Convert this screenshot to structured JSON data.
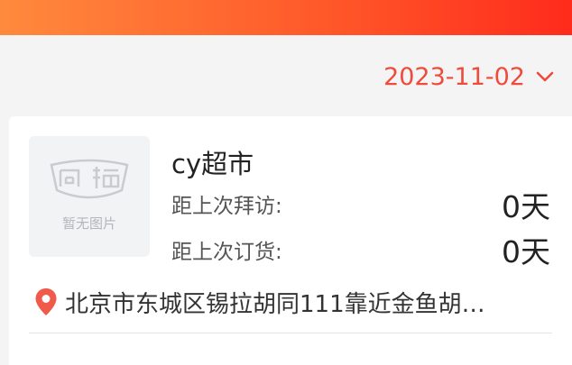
{
  "header": {
    "gradient": [
      "#ff8a3d",
      "#ff5a2a",
      "#ff2b1c"
    ]
  },
  "filter": {
    "date": "2023-11-02",
    "accent": "#f04a3c",
    "icon": "chevron-down-icon"
  },
  "store": {
    "thumbnail_placeholder": "暂无图片",
    "name": "cy超市",
    "last_visit_label": "距上次拜访:",
    "last_visit_value": "0天",
    "last_order_label": "距上次订货:",
    "last_order_value": "0天",
    "address": "北京市东城区锡拉胡同111靠近金鱼胡…",
    "address_icon": "location-pin-icon",
    "pin_color": "#f05a4a"
  }
}
